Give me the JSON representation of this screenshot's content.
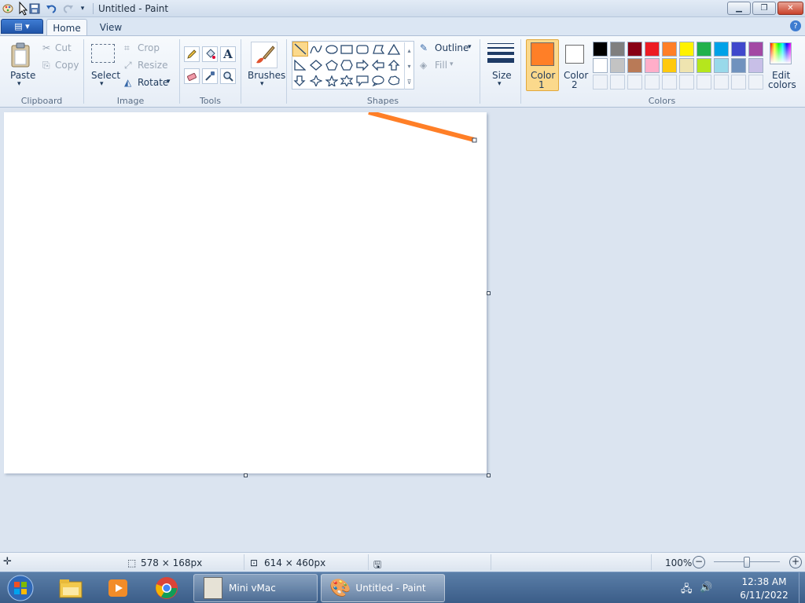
{
  "window": {
    "title": "Untitled - Paint"
  },
  "menu": {
    "file_icon": "paint-menu-icon"
  },
  "tabs": [
    {
      "label": "Home"
    },
    {
      "label": "View"
    }
  ],
  "clipboard": {
    "paste": "Paste",
    "cut": "Cut",
    "copy": "Copy",
    "group": "Clipboard"
  },
  "image": {
    "select": "Select",
    "crop": "Crop",
    "resize": "Resize",
    "rotate": "Rotate",
    "group": "Image"
  },
  "tools": {
    "group": "Tools",
    "text_glyph": "A"
  },
  "brushes": {
    "label": "Brushes"
  },
  "shapes": {
    "group": "Shapes",
    "outline": "Outline",
    "fill": "Fill"
  },
  "size": {
    "label": "Size"
  },
  "colors": {
    "color1_label": "Color",
    "color1_num": "1",
    "color2_label": "Color",
    "color2_num": "2",
    "edit_label": "Edit",
    "edit_label2": "colors",
    "group": "Colors",
    "color1": "#ff7f27",
    "color2": "#ffffff",
    "palette_row1": [
      "#000000",
      "#7f7f7f",
      "#880015",
      "#ed1c24",
      "#ff7f27",
      "#fff200",
      "#22b14c",
      "#00a2e8",
      "#3f48cc",
      "#a349a4"
    ],
    "palette_row2": [
      "#ffffff",
      "#c3c3c3",
      "#b97a57",
      "#ffaec9",
      "#ffc90e",
      "#efe4b0",
      "#b5e61d",
      "#99d9ea",
      "#7092be",
      "#c8bfe7"
    ]
  },
  "status": {
    "selection_size": "578 × 168px",
    "image_size": "614 × 460px",
    "zoom": "100%"
  },
  "taskbar": {
    "minivmac": "Mini vMac",
    "paint": "Untitled - Paint",
    "time": "12:38 AM",
    "date": "6/11/2022"
  }
}
